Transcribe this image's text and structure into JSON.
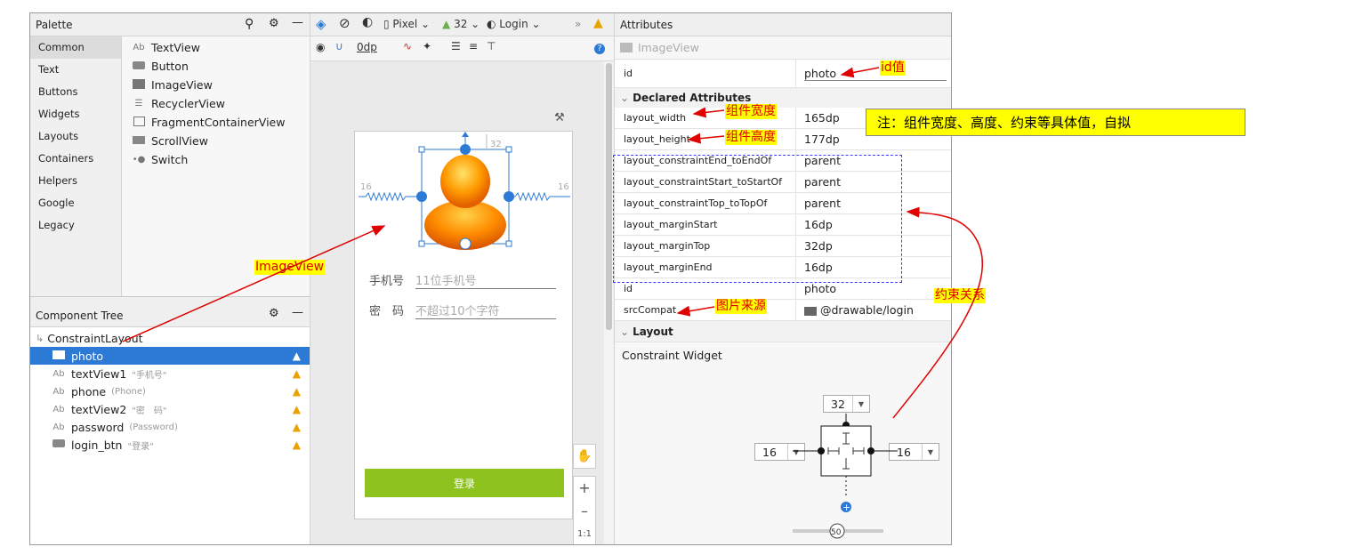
{
  "palette": {
    "title": "Palette",
    "categories": [
      "Common",
      "Text",
      "Buttons",
      "Widgets",
      "Layouts",
      "Containers",
      "Helpers",
      "Google",
      "Legacy"
    ],
    "items": [
      {
        "icon": "Ab",
        "label": "TextView"
      },
      {
        "icon": "button-icon",
        "label": "Button"
      },
      {
        "icon": "image-icon",
        "label": "ImageView"
      },
      {
        "icon": "list-icon",
        "label": "RecyclerView"
      },
      {
        "icon": "fragment-icon",
        "label": "FragmentContainerView"
      },
      {
        "icon": "scroll-icon",
        "label": "ScrollView"
      },
      {
        "icon": "switch-icon",
        "label": "Switch"
      }
    ]
  },
  "toolbar": {
    "device": "Pixel",
    "api": "32",
    "theme": "Login",
    "margin": "0dp"
  },
  "component_tree": {
    "title": "Component Tree",
    "root": "ConstraintLayout",
    "rows": [
      {
        "icon": "image-icon",
        "name": "photo",
        "text": ""
      },
      {
        "icon": "Ab",
        "name": "textView1",
        "text": "\"手机号\""
      },
      {
        "icon": "Ab",
        "name": "phone",
        "text": "(Phone)"
      },
      {
        "icon": "Ab",
        "name": "textView2",
        "text": "\"密　码\""
      },
      {
        "icon": "Ab",
        "name": "password",
        "text": "(Password)"
      },
      {
        "icon": "button-icon",
        "name": "login_btn",
        "text": "\"登录\""
      }
    ]
  },
  "preview": {
    "phone_label": "手机号",
    "phone_hint": "11位手机号",
    "pwd_label": "密　码",
    "pwd_hint": "不超过10个字符",
    "login_text": "登录",
    "margin_left": "16",
    "margin_right": "16",
    "margin_top": "32",
    "zoom_label": "1:1"
  },
  "attributes": {
    "title": "Attributes",
    "widget": "ImageView",
    "id": "photo",
    "declared_title": "Declared Attributes",
    "declared": [
      {
        "key": "layout_width",
        "value": "165dp"
      },
      {
        "key": "layout_height",
        "value": "177dp"
      },
      {
        "key": "layout_constraintEnd_toEndOf",
        "value": "parent"
      },
      {
        "key": "layout_constraintStart_toStartOf",
        "value": "parent"
      },
      {
        "key": "layout_constraintTop_toTopOf",
        "value": "parent"
      },
      {
        "key": "layout_marginStart",
        "value": "16dp"
      },
      {
        "key": "layout_marginTop",
        "value": "32dp"
      },
      {
        "key": "layout_marginEnd",
        "value": "16dp"
      },
      {
        "key": "id",
        "value": "photo"
      },
      {
        "key": "srcCompat",
        "value": "@drawable/login"
      }
    ],
    "layout_title": "Layout",
    "constraint_widget": "Constraint Widget",
    "cw_top": "32",
    "cw_left": "16",
    "cw_right": "16",
    "bias": "50"
  },
  "annotations": {
    "id_value": "id值",
    "width": "组件宽度",
    "height": "组件高度",
    "note": "注：组件宽度、高度、约束等具体值，自拟",
    "constraints": "约束关系",
    "image_source": "图片来源",
    "imageview": "ImageView"
  },
  "colors": {
    "accent": "#2d7ad6",
    "annotation_bg": "#ffff00",
    "annotation_text": "#e00000",
    "login_btn": "#8dc21f",
    "warning": "#e8a200"
  }
}
